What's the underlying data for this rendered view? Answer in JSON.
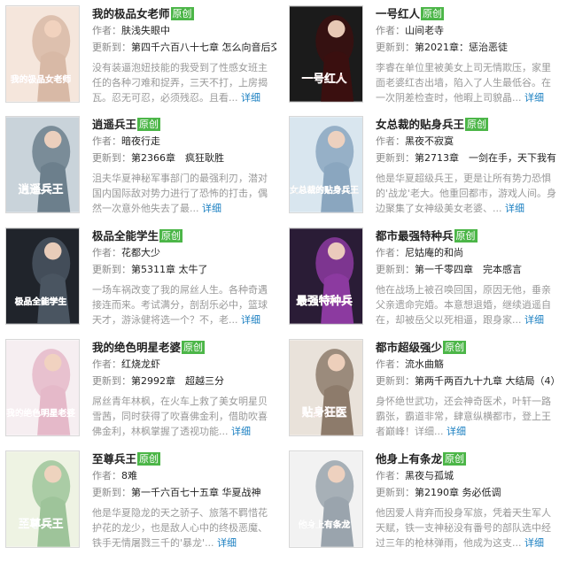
{
  "labels": {
    "author": "作者：",
    "updated": "更新到：",
    "more": "详细",
    "ellipsis": "... "
  },
  "accent": {
    "badge": "#4cb648",
    "link": "#1a7fc1"
  },
  "books": [
    {
      "title": "我的极品女老师",
      "badge": "原创",
      "author": "肤浅失眼中",
      "update": "第四千六百八十七章 怎么向音后交",
      "intro": "没有装逼泡妞技能的我受到了性感女班主任的各种刁难和捉弄，三天不打，上房揭瓦。忍无可忍，必须残忍。且看",
      "cover": {
        "text": "我的极品女老师",
        "icon": "woman-portrait-icon"
      }
    },
    {
      "title": "一号红人",
      "badge": "原创",
      "author": "山间老寺",
      "update": "第2021章：惩治恶徒",
      "intro": "李睿在单位里被美女上司无情欺压，家里面老婆红杏出墙，陷入了人生最低谷。在一次阴差检查时，他暇上司貌晶",
      "cover": {
        "text": "一号红人",
        "icon": "red-seal-icon"
      }
    },
    {
      "title": "逍遥兵王",
      "badge": "原创",
      "author": "暗夜行走",
      "update": "第2366章　疯狂耿胜",
      "intro": "沮夫华夏神秘军事部门的最强利刃，潜对国内国际敌对势力进行了恐怖的打击，偶然一次意外他失去了最",
      "cover": {
        "text": "逍遥兵王",
        "icon": "soldier-couple-icon"
      }
    },
    {
      "title": "女总裁的贴身兵王",
      "badge": "原创",
      "author": "黑夜不寂寞",
      "update": "第2713章　一剑在手，天下我有",
      "intro": "他是华夏超级兵王，更是让所有势力恐惧的'战龙'老大。他重回都市，游戏人间。身边聚集了女神级美女老婆、",
      "cover": {
        "text": "女总裁的贴身兵王",
        "icon": "ceo-couple-icon"
      }
    },
    {
      "title": "极品全能学生",
      "badge": "原创",
      "author": "花都大少",
      "update": "第5311章 太牛了",
      "intro": "一场车祸改变了我的屌丝人生。各种奇遇接连而来。考试满分，剖刮乐必中，篮球天才，游泳健将选一个？不，老",
      "cover": {
        "text": "极品全能学生",
        "icon": "student-icon"
      }
    },
    {
      "title": "都市最强特种兵",
      "badge": "原创",
      "author": "尼姑庵的和尚",
      "update": "第一千零四章　完本感言",
      "intro": "他在战场上被召唤回国，原因无他，垂亲父亲遗命完婚。本意想退婚，继续逍遥自在，却被岳父以死相逼，跟身家",
      "cover": {
        "text": "最强特种兵",
        "icon": "flame-warrior-icon"
      }
    },
    {
      "title": "我的绝色明星老婆",
      "badge": "原创",
      "author": "红烧龙虾",
      "update": "第2992章　超越三分",
      "intro": "屌丝青年林枫，在火车上救了美女明星贝雪茜，同时获得了吹喜佛金利，借助吹喜佛金利，林枫掌握了透视功能",
      "cover": {
        "text": "我的绝色明星老婆",
        "icon": "star-bride-icon"
      }
    },
    {
      "title": "都市超级强少",
      "badge": "原创",
      "author": "流水曲觞",
      "update": "第两千两百九十九章 大结局（4）",
      "intro": "身怀绝世武功，还会神奇医术，叶轩一路霸张，霸道非常，肆意纵横都市，登上王者巅峰！详细",
      "cover": {
        "text": "贴身狂医",
        "icon": "doctor-portrait-icon"
      }
    },
    {
      "title": "至尊兵王",
      "badge": "原创",
      "author": "8难",
      "update": "第一千六百七十五章 华夏战神",
      "intro": "他是华夏隐龙的天之骄子、旅落不羁惜花护花的龙少，也是敌人心中的终极恶魔、铁手无情屠戮三千的'暴龙'",
      "cover": {
        "text": "至尊兵王",
        "icon": "soldier-girl-icon"
      }
    },
    {
      "title": "他身上有条龙",
      "badge": "原创",
      "author": "黑夜与孤城",
      "update": "第2190章 务必低调",
      "intro": "他因爱人背弃而投身军旅，凭着天生军人天赋，铁一支神秘没有番号的部队选中经过三年的枪林弹雨，他成为这支",
      "cover": {
        "text": "他身上有条龙",
        "icon": "dragon-man-icon"
      }
    }
  ]
}
